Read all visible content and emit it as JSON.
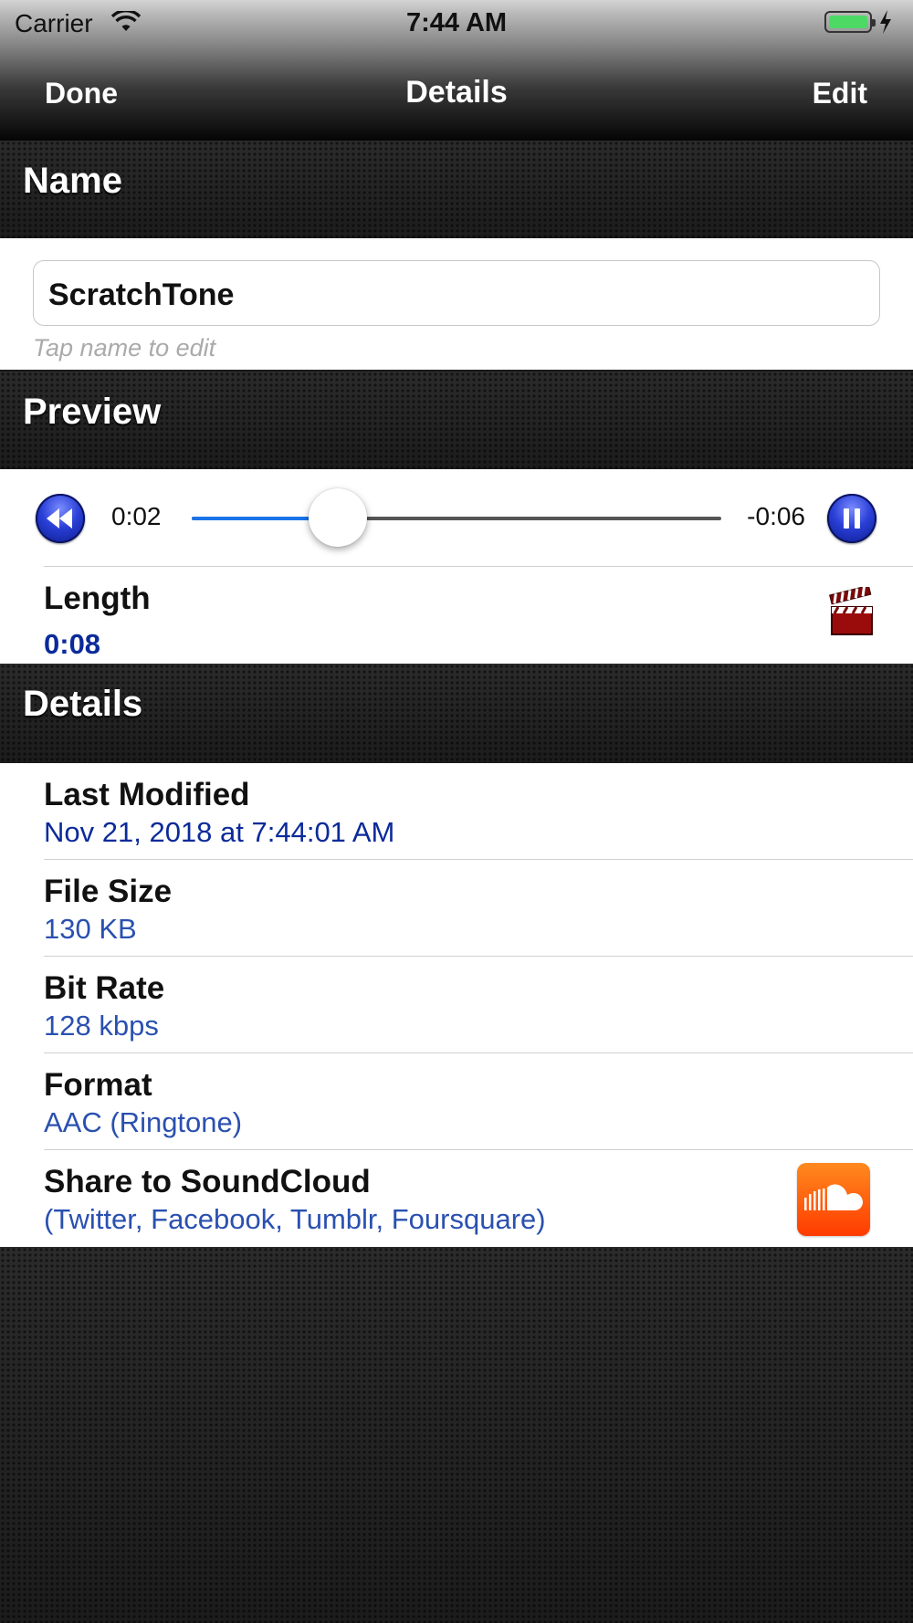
{
  "status_bar": {
    "carrier": "Carrier",
    "time": "7:44 AM",
    "wifi_icon": "wifi-icon",
    "battery_icon": "battery-icon",
    "charging_icon": "charging-bolt-icon"
  },
  "nav": {
    "left_button": "Done",
    "title": "Details",
    "right_button": "Edit"
  },
  "sections": {
    "name": "Name",
    "preview": "Preview",
    "details": "Details"
  },
  "name_field": {
    "value": "ScratchTone",
    "hint": "Tap name to edit"
  },
  "player": {
    "elapsed": "0:02",
    "remaining": "-0:06",
    "progress_fraction": 0.275,
    "rewind_icon": "rewind-icon",
    "pause_icon": "pause-icon",
    "accent": "#1a73e8"
  },
  "length": {
    "label": "Length",
    "value": "0:08",
    "icon": "clapperboard-icon"
  },
  "details": [
    {
      "label": "Last Modified",
      "value": "Nov 21, 2018 at 7:44:01 AM"
    },
    {
      "label": "File Size",
      "value": "130 KB"
    },
    {
      "label": "Bit Rate",
      "value": "128 kbps"
    },
    {
      "label": "Format",
      "value": "AAC (Ringtone)"
    },
    {
      "label": "Share to SoundCloud",
      "value": "(Twitter, Facebook, Tumblr, Foursquare)",
      "icon": "soundcloud-icon"
    }
  ]
}
